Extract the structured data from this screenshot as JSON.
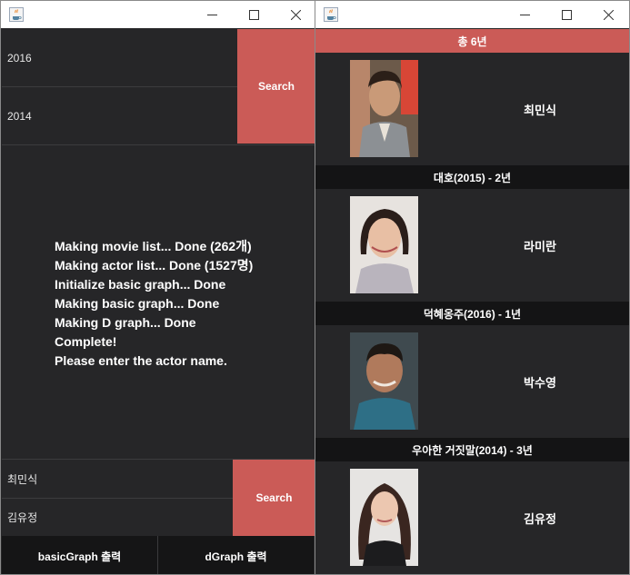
{
  "left_window": {
    "year_field_1": "2016",
    "year_field_2": "2014",
    "search_top_label": "Search",
    "log_lines": [
      "Making movie list... Done (262개)",
      "Making actor list... Done (1527명)",
      "Initialize basic graph... Done",
      "Making basic graph... Done",
      "Making D graph... Done",
      "Complete!",
      "Please enter the actor name."
    ],
    "actor_field_1": "최민식",
    "actor_field_2": "김유정",
    "search_bottom_label": "Search",
    "basic_graph_label": "basicGraph 출력",
    "d_graph_label": "dGraph 출력"
  },
  "right_window": {
    "total_label": "총 6년",
    "actors": [
      {
        "name": "최민식"
      },
      {
        "name": "라미란"
      },
      {
        "name": "박수영"
      },
      {
        "name": "김유정"
      }
    ],
    "movies": [
      "대호(2015) - 2년",
      "덕혜옹주(2016) - 1년",
      "우아한 거짓말(2014) - 3년"
    ]
  },
  "colors": {
    "accent": "#cb5b57",
    "panel": "#262628",
    "dark_bar": "#141415"
  }
}
